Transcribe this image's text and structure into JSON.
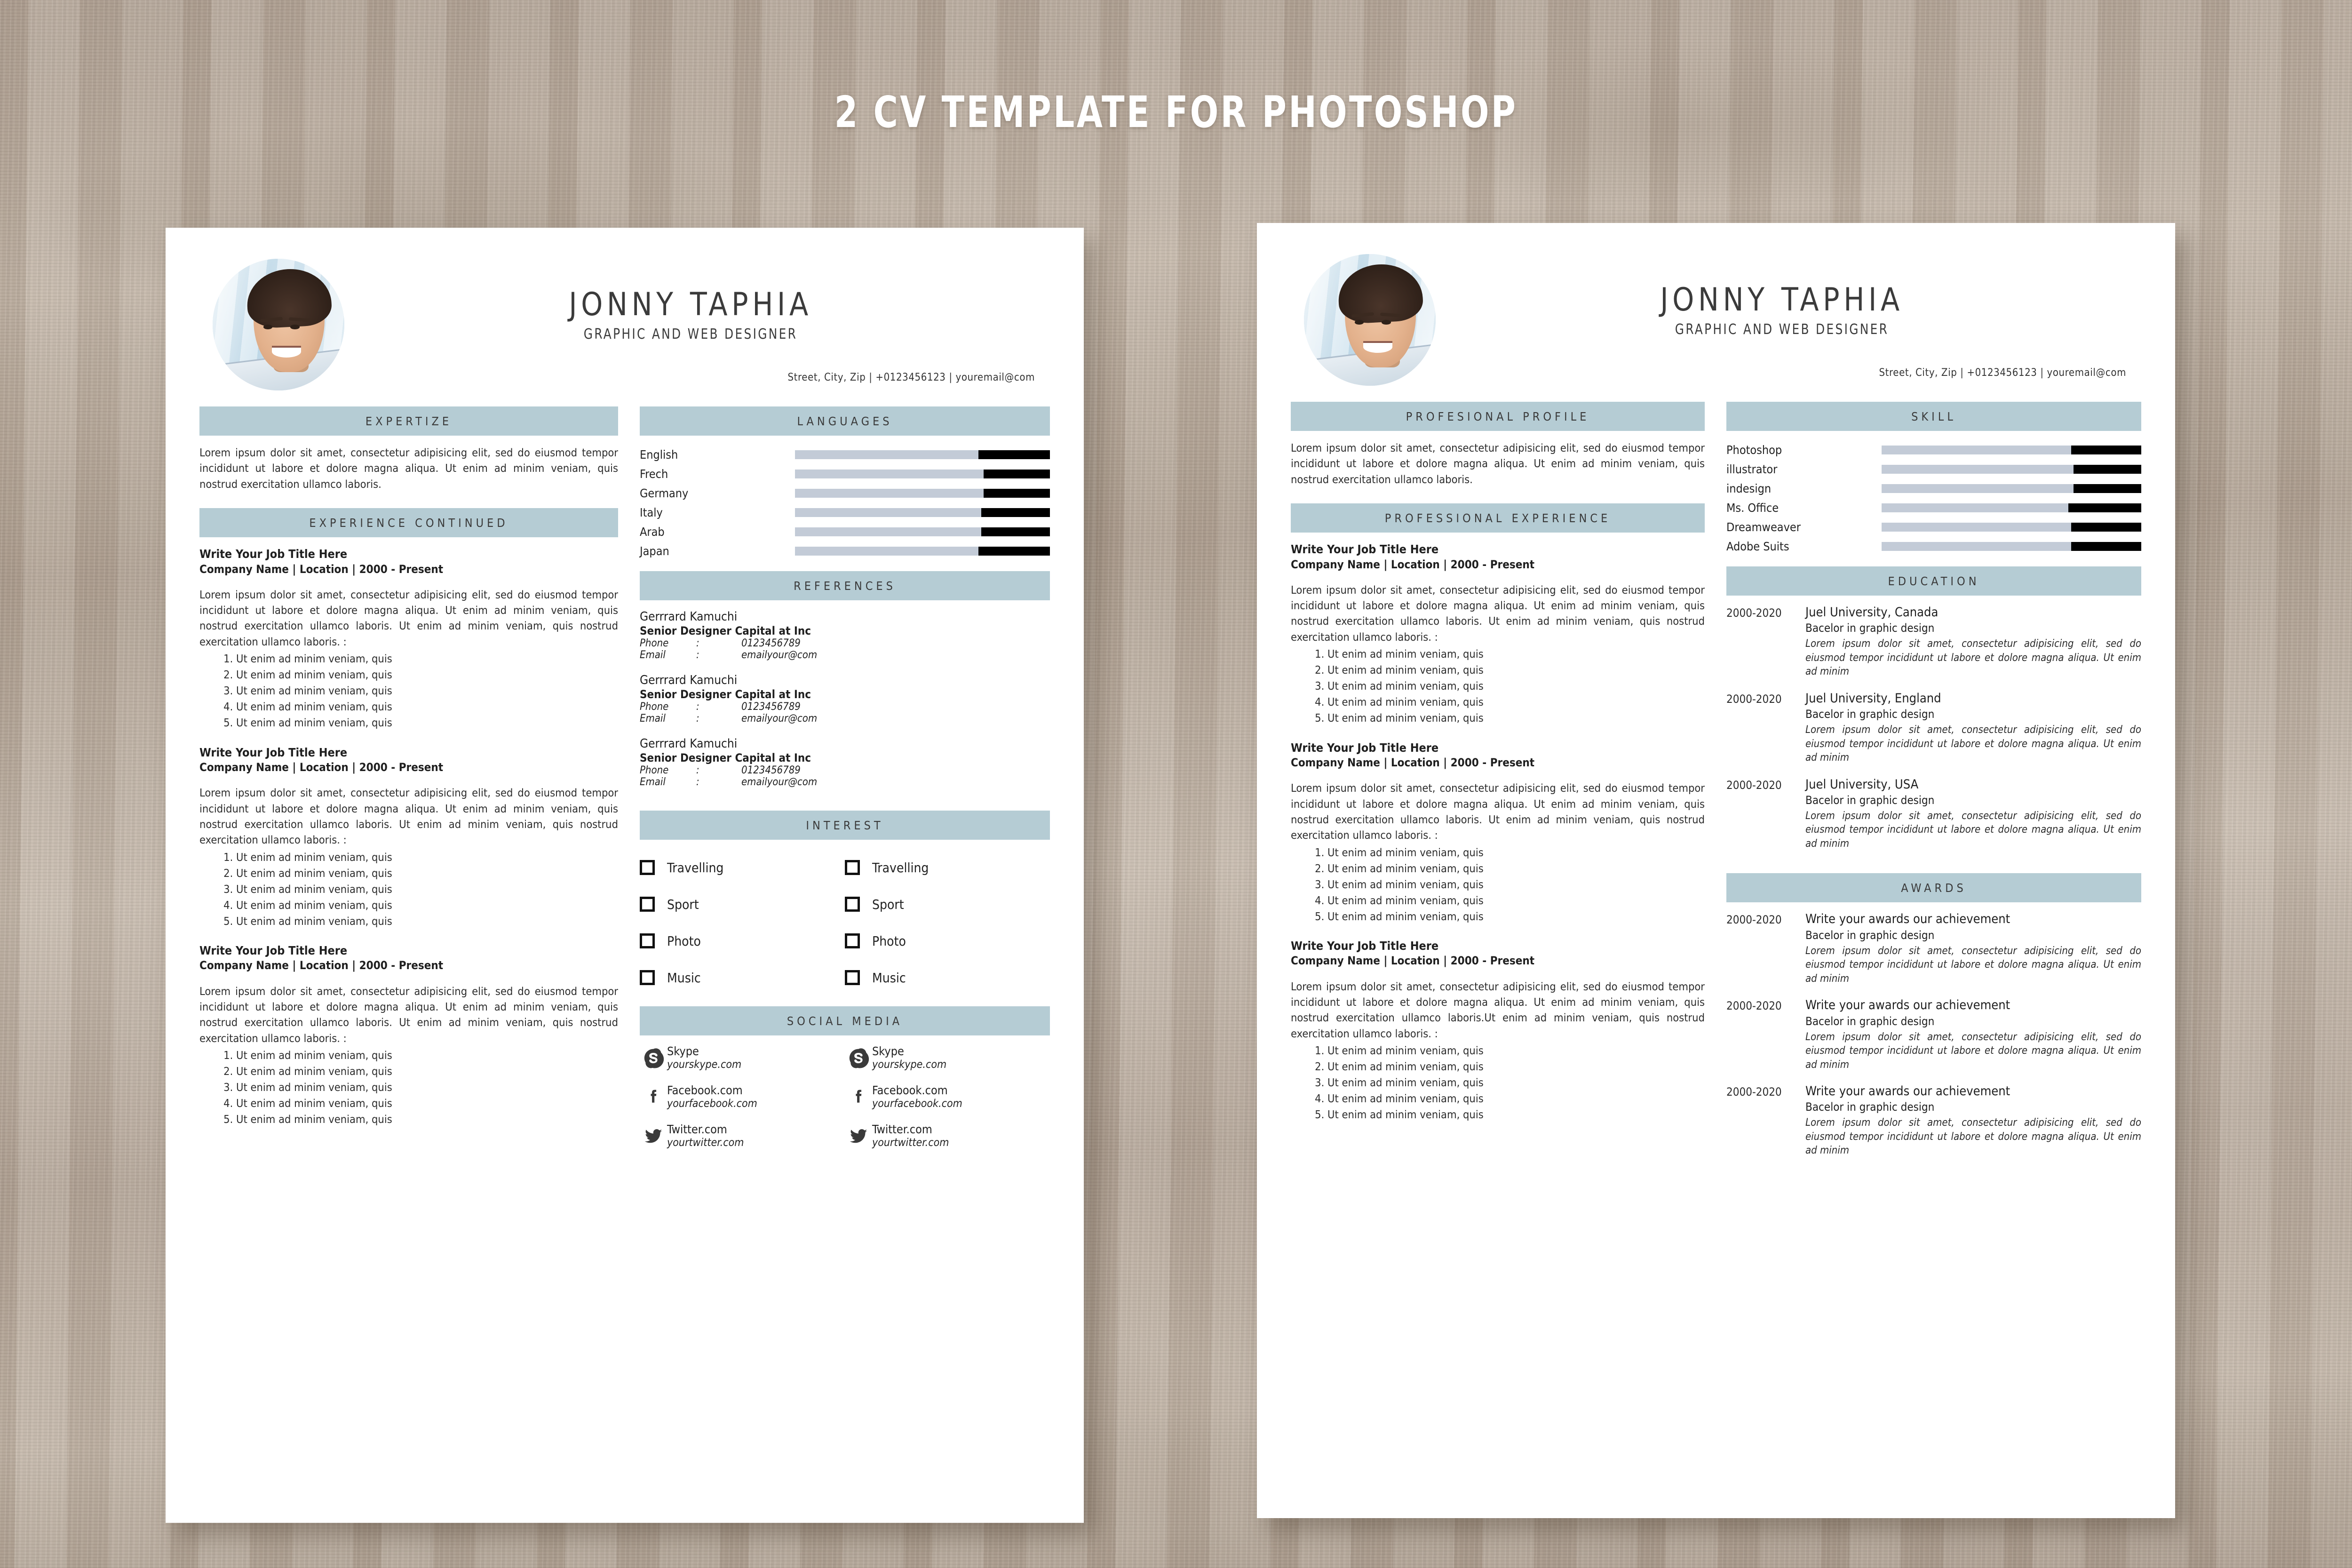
{
  "banner": {
    "title": "2 CV TEMPLATE FOR PHOTOSHOP"
  },
  "profile": {
    "name": "JONNY TAPHIA",
    "role": "GRAPHIC AND WEB DESIGNER",
    "contact": "Street, City, Zip | +0123456123 | youremail@com",
    "avatar_icon": "user-photo"
  },
  "colors": {
    "section_bar": "#b5ccd4",
    "meter_track": "#c3cbd7",
    "meter_fill": "#000000",
    "page_background": "#ffffff",
    "desk_background": "#b6a99b"
  },
  "lorem": {
    "short": "Lorem ipsum dolor sit amet, consectetur adipisicing elit, sed do eiusmod tempor incididunt ut labore et dolore magna aliqua. Ut enim ad minim veniam, quis nostrud exercitation ullamco laboris.",
    "long": "Lorem ipsum dolor sit amet, consectetur adipisicing elit, sed do eiusmod tempor incididunt ut labore et dolore magna aliqua. Ut enim ad minim veniam, quis nostrud exercitation ullamco laboris. Ut enim ad minim veniam, quis nostrud exercitation ullamco laboris. :",
    "long_alt": "Lorem ipsum dolor sit amet, consectetur adipisicing elit, sed do eiusmod tempor incididunt ut labore et dolore magna aliqua. Ut enim ad minim veniam, quis nostrud exercitation ullamco laboris.Ut enim ad minim veniam, quis nostrud exercitation ullamco laboris. :",
    "italic": "Lorem ipsum dolor sit amet, consectetur adipisicing elit, sed do eiusmod tempor incididunt ut labore et dolore magna aliqua. Ut enim ad minim",
    "bullet": "Ut enim ad minim veniam, quis"
  },
  "page1": {
    "sections": {
      "expertize": "EXPERTIZE",
      "experience_continued": "EXPERIENCE CONTINUED",
      "languages": "LANGUAGES",
      "references": "REFERENCES",
      "interest": "INTEREST",
      "social_media": "SOCIAL MEDIA"
    },
    "experience": [
      {
        "title": "Write Your Job Title Here",
        "meta": "Company Name | Location | 2000 - Present"
      },
      {
        "title": "Write Your Job Title Here",
        "meta": "Company Name | Location | 2000 - Present"
      },
      {
        "title": "Write Your Job Title Here",
        "meta": "Company Name | Location | 2000 - Present"
      }
    ],
    "languages": [
      {
        "label": "English",
        "value": 28
      },
      {
        "label": "Frech",
        "value": 26
      },
      {
        "label": "Germany",
        "value": 26
      },
      {
        "label": "Italy",
        "value": 27
      },
      {
        "label": "Arab",
        "value": 27
      },
      {
        "label": "Japan",
        "value": 28
      }
    ],
    "references": [
      {
        "name": "Gerrrard Kamuchi",
        "role": "Senior Designer Capital at Inc",
        "phone_label": "Phone",
        "phone": "0123456789",
        "email_label": "Email",
        "email": "emailyour@com"
      },
      {
        "name": "Gerrrard Kamuchi",
        "role": "Senior Designer Capital at Inc",
        "phone_label": "Phone",
        "phone": "0123456789",
        "email_label": "Email",
        "email": "emailyour@com"
      },
      {
        "name": "Gerrrard Kamuchi",
        "role": "Senior Designer Capital at Inc",
        "phone_label": "Phone",
        "phone": "0123456789",
        "email_label": "Email",
        "email": "emailyour@com"
      }
    ],
    "interest_left": [
      "Travelling",
      "Sport",
      "Photo",
      "Music"
    ],
    "interest_right": [
      "Travelling",
      "Sport",
      "Photo",
      "Music"
    ],
    "social_left": [
      {
        "icon": "skype-icon",
        "title": "Skype",
        "handle": "yourskype.com"
      },
      {
        "icon": "facebook-icon",
        "title": "Facebook.com",
        "handle": "yourfacebook.com"
      },
      {
        "icon": "twitter-icon",
        "title": "Twitter.com",
        "handle": "yourtwitter.com"
      }
    ],
    "social_right": [
      {
        "icon": "skype-icon",
        "title": "Skype",
        "handle": "yourskype.com"
      },
      {
        "icon": "facebook-icon",
        "title": "Facebook.com",
        "handle": "yourfacebook.com"
      },
      {
        "icon": "twitter-icon",
        "title": "Twitter.com",
        "handle": "yourtwitter.com"
      }
    ]
  },
  "page2": {
    "sections": {
      "profesional_profile": "PROFESIONAL PROFILE",
      "professional_experience": "PROFESSIONAL EXPERIENCE",
      "skill": "SKILL",
      "education": "EDUCATION",
      "awards": "AWARDS"
    },
    "experience": [
      {
        "title": "Write Your Job Title Here",
        "meta": "Company Name | Location | 2000 - Present"
      },
      {
        "title": "Write Your Job Title Here",
        "meta": "Company Name | Location | 2000 - Present"
      },
      {
        "title": "Write Your Job Title Here",
        "meta": "Company Name | Location | 2000 - Present"
      }
    ],
    "skills": [
      {
        "label": "Photoshop",
        "value": 27
      },
      {
        "label": "illustrator",
        "value": 26
      },
      {
        "label": "indesign",
        "value": 26
      },
      {
        "label": "Ms. Office",
        "value": 28
      },
      {
        "label": "Dreamweaver",
        "value": 27
      },
      {
        "label": "Adobe Suits",
        "value": 27
      }
    ],
    "education": [
      {
        "year": "2000-2020",
        "title": "Juel University, Canada",
        "subtitle": "Bacelor in graphic design"
      },
      {
        "year": "2000-2020",
        "title": "Juel University, England",
        "subtitle": "Bacelor in graphic design"
      },
      {
        "year": "2000-2020",
        "title": "Juel University, USA",
        "subtitle": "Bacelor in graphic design"
      }
    ],
    "awards": [
      {
        "year": "2000-2020",
        "title": "Write your awards our achievement",
        "subtitle": "Bacelor in graphic design"
      },
      {
        "year": "2000-2020",
        "title": "Write your awards our achievement",
        "subtitle": "Bacelor in graphic design"
      },
      {
        "year": "2000-2020",
        "title": "Write your awards our achievement",
        "subtitle": "Bacelor in graphic design"
      }
    ]
  }
}
